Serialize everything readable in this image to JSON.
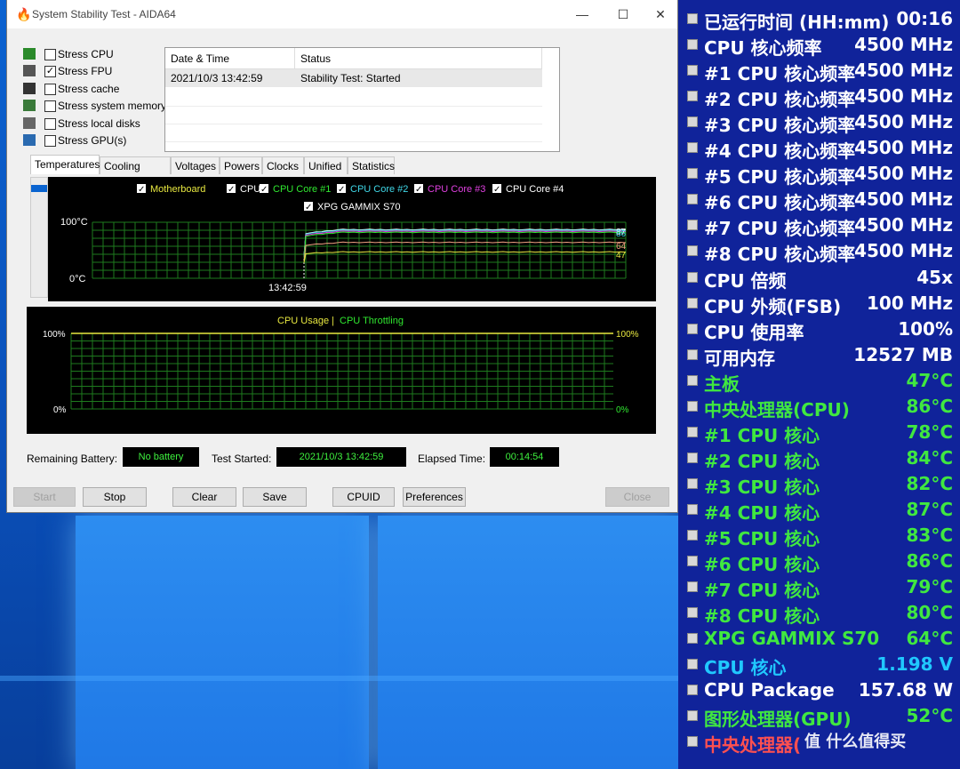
{
  "window": {
    "title": "System Stability Test - AIDA64",
    "controls": {
      "minimize": "—",
      "maximize": "☐",
      "close": "✕"
    }
  },
  "stress_options": [
    {
      "label": "Stress CPU",
      "checked": false,
      "icon": "cpu-chip-icon"
    },
    {
      "label": "Stress FPU",
      "checked": true,
      "icon": "fpu-chip-icon"
    },
    {
      "label": "Stress cache",
      "checked": false,
      "icon": "cache-icon"
    },
    {
      "label": "Stress system memory",
      "checked": false,
      "icon": "memory-icon"
    },
    {
      "label": "Stress local disks",
      "checked": false,
      "icon": "disk-icon"
    },
    {
      "label": "Stress GPU(s)",
      "checked": false,
      "icon": "gpu-icon"
    }
  ],
  "log": {
    "headers": {
      "date": "Date & Time",
      "status": "Status"
    },
    "rows": [
      {
        "date": "2021/10/3 13:42:59",
        "status": "Stability Test: Started"
      }
    ]
  },
  "tabs": [
    "Temperatures",
    "Cooling Fans",
    "Voltages",
    "Powers",
    "Clocks",
    "Unified",
    "Statistics"
  ],
  "active_tab": "Temperatures",
  "temp_chart": {
    "legend": [
      {
        "label": "Motherboard",
        "color": "#e8e840"
      },
      {
        "label": "CPU",
        "color": "#ffffff"
      },
      {
        "label": "CPU Core #1",
        "color": "#30e830"
      },
      {
        "label": "CPU Core #2",
        "color": "#40d8e8"
      },
      {
        "label": "CPU Core #3",
        "color": "#e040e0"
      },
      {
        "label": "CPU Core #4",
        "color": "#ffffff"
      },
      {
        "label": "XPG GAMMIX S70",
        "color": "#ffffff"
      }
    ],
    "y_top": "100°C",
    "y_bottom": "0°C",
    "x_label": "13:42:59",
    "end_values": [
      "87",
      "86",
      "64",
      "47"
    ]
  },
  "usage_chart": {
    "legend_usage": "CPU Usage",
    "legend_sep": "|",
    "legend_throttle": "CPU Throttling",
    "left_top": "100%",
    "left_bottom": "0%",
    "right_top": "100%",
    "right_bottom": "0%"
  },
  "status_bar": {
    "battery_label": "Remaining Battery:",
    "battery_value": "No battery",
    "started_label": "Test Started:",
    "started_value": "2021/10/3 13:42:59",
    "elapsed_label": "Elapsed Time:",
    "elapsed_value": "00:14:54"
  },
  "buttons": {
    "start": "Start",
    "stop": "Stop",
    "clear": "Clear",
    "save": "Save",
    "cpuid": "CPUID",
    "preferences": "Preferences",
    "close": "Close"
  },
  "osd": [
    {
      "label": "已运行时间 (HH:mm)",
      "value": "00:16",
      "color": "#ffffff",
      "icon": "clock-icon"
    },
    {
      "label": "CPU 核心频率",
      "value": "4500 MHz",
      "color": "#ffffff",
      "icon": "cpu-icon"
    },
    {
      "label": "#1 CPU 核心频率",
      "value": "4500 MHz",
      "color": "#ffffff",
      "icon": "cpu-icon"
    },
    {
      "label": "#2 CPU 核心频率",
      "value": "4500 MHz",
      "color": "#ffffff",
      "icon": "cpu-icon"
    },
    {
      "label": "#3 CPU 核心频率",
      "value": "4500 MHz",
      "color": "#ffffff",
      "icon": "cpu-icon"
    },
    {
      "label": "#4 CPU 核心频率",
      "value": "4500 MHz",
      "color": "#ffffff",
      "icon": "cpu-icon"
    },
    {
      "label": "#5 CPU 核心频率",
      "value": "4500 MHz",
      "color": "#ffffff",
      "icon": "cpu-icon"
    },
    {
      "label": "#6 CPU 核心频率",
      "value": "4500 MHz",
      "color": "#ffffff",
      "icon": "cpu-icon"
    },
    {
      "label": "#7 CPU 核心频率",
      "value": "4500 MHz",
      "color": "#ffffff",
      "icon": "cpu-icon"
    },
    {
      "label": "#8 CPU 核心频率",
      "value": "4500 MHz",
      "color": "#ffffff",
      "icon": "cpu-icon"
    },
    {
      "label": "CPU 倍频",
      "value": "45x",
      "color": "#ffffff",
      "icon": "cpu-icon"
    },
    {
      "label": "CPU 外频(FSB)",
      "value": "100 MHz",
      "color": "#ffffff",
      "icon": "cpu-icon"
    },
    {
      "label": "CPU 使用率",
      "value": "100%",
      "color": "#ffffff",
      "icon": "hourglass-icon"
    },
    {
      "label": "可用内存",
      "value": "12527 MB",
      "color": "#ffffff",
      "icon": "memory-icon"
    },
    {
      "label": "主板",
      "value": "47°C",
      "color": "#40e840",
      "icon": "motherboard-icon"
    },
    {
      "label": "中央处理器(CPU)",
      "value": "86°C",
      "color": "#40e840",
      "icon": "cpu-icon"
    },
    {
      "label": " #1 CPU 核心",
      "value": "78°C",
      "color": "#40e840",
      "icon": "cpu-icon"
    },
    {
      "label": " #2 CPU 核心",
      "value": "84°C",
      "color": "#40e840",
      "icon": "cpu-icon"
    },
    {
      "label": " #3 CPU 核心",
      "value": "82°C",
      "color": "#40e840",
      "icon": "cpu-icon"
    },
    {
      "label": " #4 CPU 核心",
      "value": "87°C",
      "color": "#40e840",
      "icon": "cpu-icon"
    },
    {
      "label": " #5 CPU 核心",
      "value": "83°C",
      "color": "#40e840",
      "icon": "cpu-icon"
    },
    {
      "label": " #6 CPU 核心",
      "value": "86°C",
      "color": "#40e840",
      "icon": "cpu-icon"
    },
    {
      "label": " #7 CPU 核心",
      "value": "79°C",
      "color": "#40e840",
      "icon": "cpu-icon"
    },
    {
      "label": " #8 CPU 核心",
      "value": "80°C",
      "color": "#40e840",
      "icon": "cpu-icon"
    },
    {
      "label": "XPG GAMMIX S70",
      "value": "64°C",
      "color": "#40e840",
      "icon": "disk-icon"
    },
    {
      "label": "CPU 核心",
      "value": "1.198 V",
      "color": "#20c8ff",
      "icon": "cpu-icon"
    },
    {
      "label": "CPU Package",
      "value": "157.68 W",
      "color": "#ffffff",
      "icon": "cpu-icon"
    },
    {
      "label": "图形处理器(GPU)",
      "value": "52°C",
      "color": "#40e840",
      "icon": "gpu-icon"
    },
    {
      "label": "中央处理器(",
      "value": "",
      "color": "#ff5050",
      "icon": "cpu-icon"
    }
  ],
  "watermark": "值 什么值得买"
}
